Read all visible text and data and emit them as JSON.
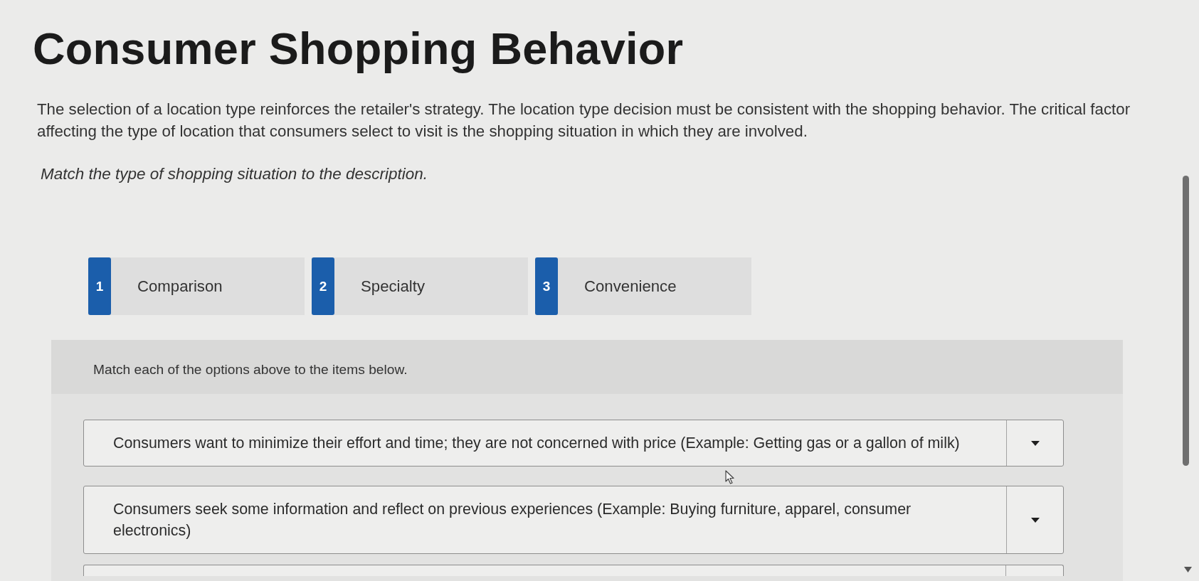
{
  "title": "Consumer Shopping Behavior",
  "intro": "The selection of a location type reinforces the retailer's strategy. The location type decision must be consistent with the shopping behavior. The critical factor affecting the type of location that consumers select to visit is the shopping situation in which they are involved.",
  "instruction": "Match the type of shopping situation to the description.",
  "options": [
    {
      "number": "1",
      "label": "Comparison"
    },
    {
      "number": "2",
      "label": "Specialty"
    },
    {
      "number": "3",
      "label": "Convenience"
    }
  ],
  "match_panel": {
    "prompt": "Match each of the options above to the items below.",
    "items": [
      {
        "text": "Consumers want to minimize their effort and time; they are not concerned with price (Example: Getting gas or a gallon of milk)"
      },
      {
        "text": "Consumers seek some information and reflect on previous experiences (Example: Buying furniture, apparel, consumer electronics)"
      }
    ],
    "more_items_below": true
  }
}
